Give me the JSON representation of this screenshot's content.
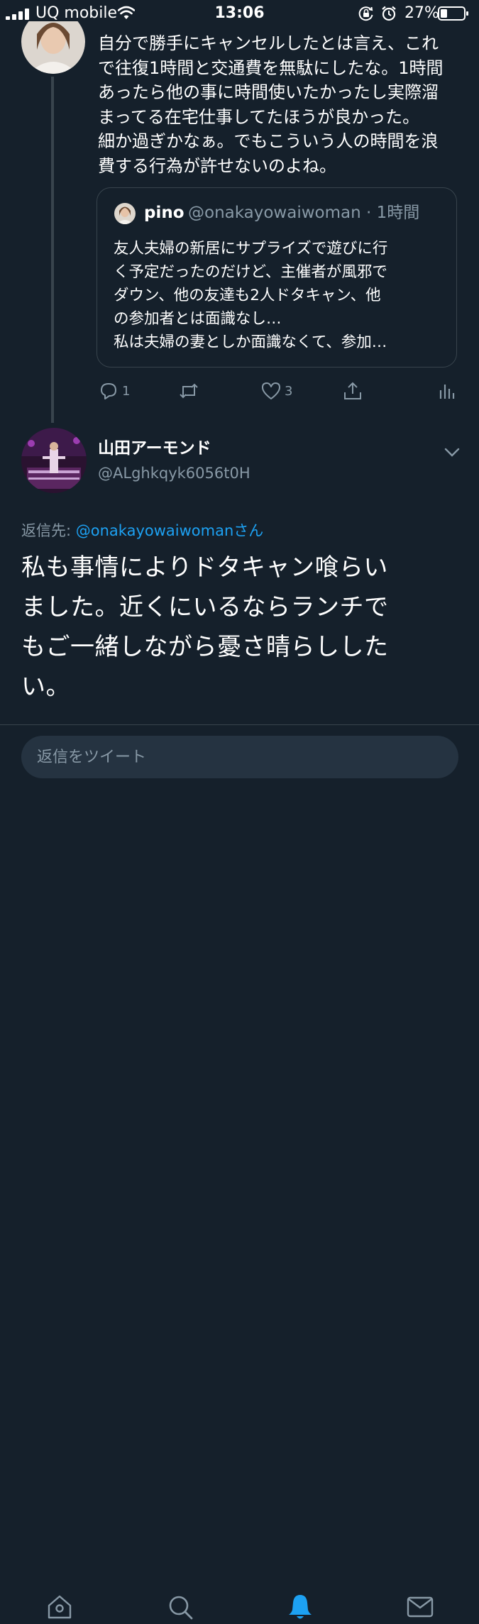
{
  "status_bar": {
    "carrier": "UQ mobile",
    "time": "13:06",
    "battery": "27%",
    "icons": [
      "signal-icon",
      "wifi-icon",
      "rotation-lock-icon",
      "alarm-icon",
      "battery-icon"
    ]
  },
  "tweet1": {
    "text": "自分で勝手にキャンセルしたとは言え、これ\nで往復1時間と交通費を無駄にしたな。1時間\nあったら他の事に時間使いたかったし実際溜\nまってる在宅仕事してたほうが良かった。\n細か過ぎかなぁ。でもこういう人の時間を浪\n費する行為が許せないのよね。",
    "quote": {
      "name": "pino",
      "handle_time": "@onakayowaiwoman · 1時間",
      "text": "友人夫婦の新居にサプライズで遊びに行\nく予定だったのだけど、主催者が風邪で\nダウン、他の友達も2人ドタキャン、他\nの参加者とは面識なし…\n私は夫婦の妻としか面識なくて、参加…"
    },
    "actions": {
      "reply_count": "1",
      "retweet_count": "",
      "like_count": "3"
    }
  },
  "tweet2": {
    "name": "山田アーモンド",
    "handle": "@ALghkqyk6056t0H",
    "reply_prefix": "返信先: ",
    "reply_mention": "@onakayowaiwomanさん",
    "text": "私も事情によりドタキャン喰らい\nました。近くにいるならランチで\nもご一緒しながら憂さ晴らしした\nい。"
  },
  "reply_box": {
    "placeholder": "返信をツイート"
  },
  "tab_bar": {
    "tabs": [
      "home-icon",
      "search-icon",
      "notifications-icon",
      "messages-icon"
    ],
    "active": "notifications-icon"
  },
  "colors": {
    "background": "#15202b",
    "accent": "#1da1f2",
    "secondary_text": "#8899a6",
    "border": "#38444d"
  }
}
